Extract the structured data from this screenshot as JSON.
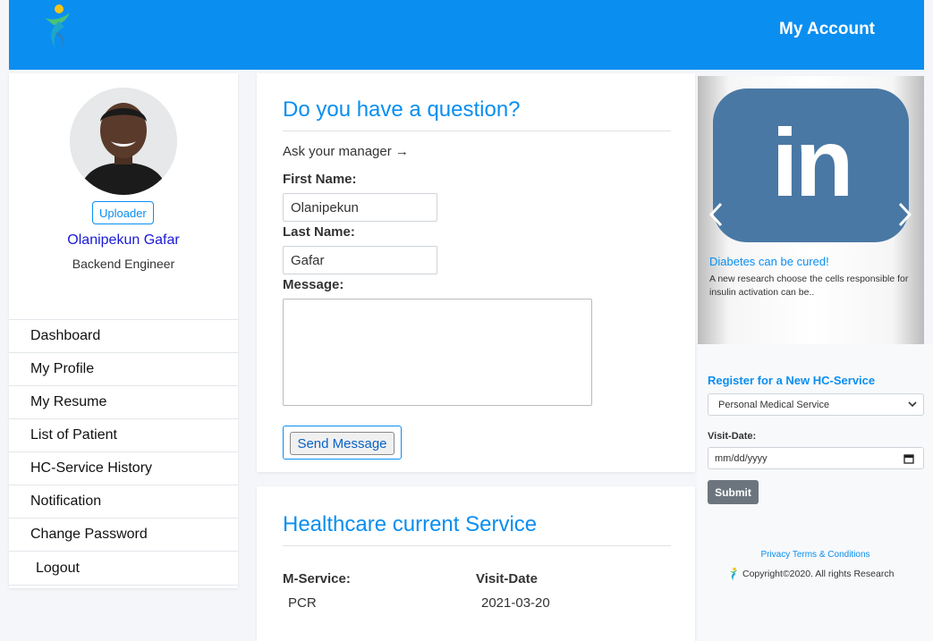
{
  "header": {
    "account_label": "My Account"
  },
  "profile": {
    "uploader_label": "Uploader",
    "name": "Olanipekun Gafar",
    "role": "Backend Engineer"
  },
  "sidebar": {
    "items": [
      {
        "label": "Dashboard"
      },
      {
        "label": "My Profile"
      },
      {
        "label": "My Resume"
      },
      {
        "label": "List of Patient"
      },
      {
        "label": "HC-Service History"
      },
      {
        "label": "Notification"
      },
      {
        "label": "Change Password"
      },
      {
        "label": "Logout"
      }
    ]
  },
  "question_form": {
    "title": "Do you have a question?",
    "ask_text": "Ask your manager →",
    "first_name_label": "First Name:",
    "first_name_value": "Olanipekun",
    "last_name_label": "Last Name:",
    "last_name_value": "Gafar",
    "message_label": "Message:",
    "message_value": "",
    "send_label": "Send Message"
  },
  "service": {
    "title": "Healthcare current Service",
    "col_service": "M-Service:",
    "col_date": "Visit-Date",
    "service_value": "PCR",
    "date_value": "2021-03-20"
  },
  "carousel": {
    "logo_text": "in",
    "slide_title": "Diabetes can be cured!",
    "slide_text": "A new research choose the cells responsible for insulin activation can be.."
  },
  "register": {
    "title": "Register for a New HC-Service",
    "selected_option": "Personal Medical Service",
    "visit_label": "Visit-Date:",
    "date_placeholder": "mm/dd/yyyy",
    "submit_label": "Submit"
  },
  "footer": {
    "privacy_label": "Privacy Terms & Conditions",
    "copyright": "Copyright©2020. All rights Research"
  },
  "colors": {
    "brand_blue": "#0a8ef0",
    "linkedin_blue": "#4978a4",
    "submit_gray": "#6c757d"
  }
}
